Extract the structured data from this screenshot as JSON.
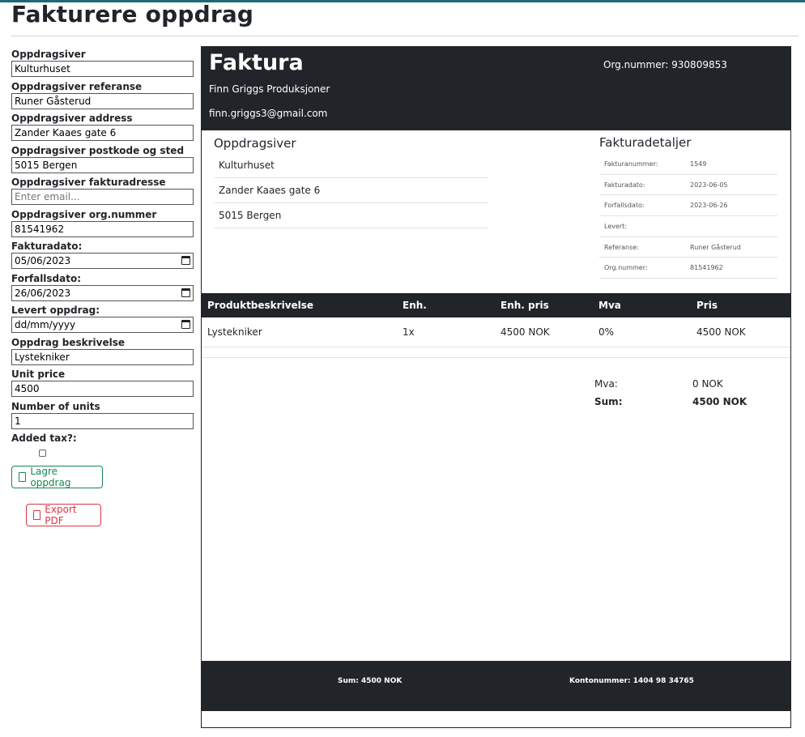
{
  "page": {
    "title": "Fakturere oppdrag"
  },
  "form": {
    "fields": [
      {
        "label": "Oppdragsiver",
        "value": "Kulturhuset"
      },
      {
        "label": "Oppdragsiver referanse",
        "value": "Runer Gåsterud"
      },
      {
        "label": "Oppdragsiver address",
        "value": "Zander Kaaes gate 6"
      },
      {
        "label": "Oppdragsiver postkode og sted",
        "value": "5015 Bergen"
      },
      {
        "label": "Oppdragsiver fakturadresse",
        "value": "",
        "placeholder": "Enter email..."
      },
      {
        "label": "Oppdragsiver org.nummer",
        "value": "81541962"
      },
      {
        "label": "Fakturadato:",
        "value": "05/06/2023"
      },
      {
        "label": "Forfallsdato:",
        "value": "26/06/2023"
      },
      {
        "label": "Levert oppdrag:",
        "value": "",
        "placeholder": "dd/mm/yyyy"
      },
      {
        "label": "Oppdrag beskrivelse",
        "value": "Lystekniker"
      },
      {
        "label": "Unit price",
        "value": "4500"
      },
      {
        "label": "Number of units",
        "value": "1"
      }
    ],
    "tax_label": "Added tax?:",
    "tax_checked": false,
    "save_label": "Lagre oppdrag",
    "export_label": "Export PDF"
  },
  "invoice": {
    "title": "Faktura",
    "company": "Finn Griggs Produksjoner",
    "email": "finn.griggs3@gmail.com",
    "org": "Org.nummer: 930809853",
    "client_title": "Oppdragsiver",
    "client_lines": [
      "Kulturhuset",
      "Zander Kaaes gate 6",
      "5015 Bergen"
    ],
    "details_title": "Fakturadetaljer",
    "details": [
      {
        "k": "Fakturanummer:",
        "v": "1549"
      },
      {
        "k": "Fakturadato:",
        "v": "2023-06-05"
      },
      {
        "k": "Forfallsdato:",
        "v": "2023-06-26"
      },
      {
        "k": "Levert:",
        "v": ""
      },
      {
        "k": "Referanse:",
        "v": "Runer Gåsterud"
      },
      {
        "k": "Org.nummer:",
        "v": "81541962"
      }
    ],
    "table": {
      "headers": [
        "Produktbeskrivelse",
        "Enh.",
        "Enh. pris",
        "Mva",
        "Pris"
      ],
      "rows": [
        [
          "Lystekniker",
          "1x",
          "4500 NOK",
          "0%",
          "4500 NOK"
        ]
      ]
    },
    "totals": {
      "mva_label": "Mva:",
      "mva_value": "0 NOK",
      "sum_label": "Sum:",
      "sum_value": "4500 NOK"
    },
    "footer": {
      "sum": "Sum: 4500 NOK",
      "account": "Kontonummer: 1404 98 34765"
    }
  }
}
